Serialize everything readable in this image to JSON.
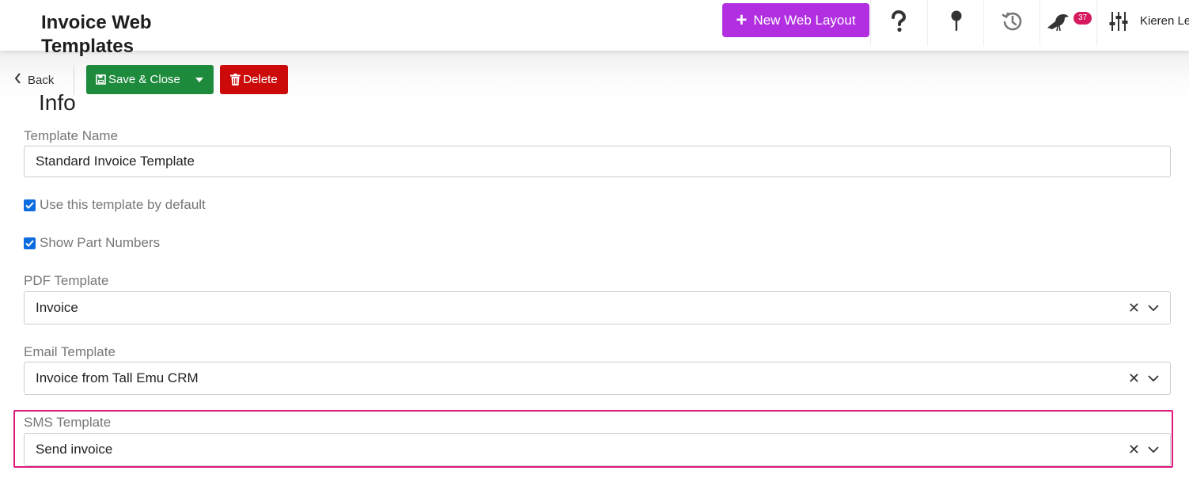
{
  "header": {
    "title": "Invoice Web Templates",
    "new_button_label": "New Web Layout",
    "notification_count": "37",
    "user_name": "Kieren Le"
  },
  "toolbar": {
    "back_label": "Back",
    "save_label": "Save & Close",
    "delete_label": "Delete"
  },
  "section": {
    "title": "Info"
  },
  "form": {
    "template_name": {
      "label": "Template Name",
      "value": "Standard Invoice Template"
    },
    "use_default": {
      "label": "Use this template by default",
      "checked": true
    },
    "show_part_numbers": {
      "label": "Show Part Numbers",
      "checked": true
    },
    "pdf_template": {
      "label": "PDF Template",
      "value": "Invoice"
    },
    "email_template": {
      "label": "Email Template",
      "value": "Invoice from Tall Emu CRM"
    },
    "sms_template": {
      "label": "SMS Template",
      "value": "Send invoice"
    }
  },
  "colors": {
    "accent_purple": "#b12fe0",
    "save_green": "#1d8a3c",
    "delete_red": "#cc0a0a",
    "highlight_pink": "#e0197c",
    "checkbox_blue": "#0a6cde"
  }
}
